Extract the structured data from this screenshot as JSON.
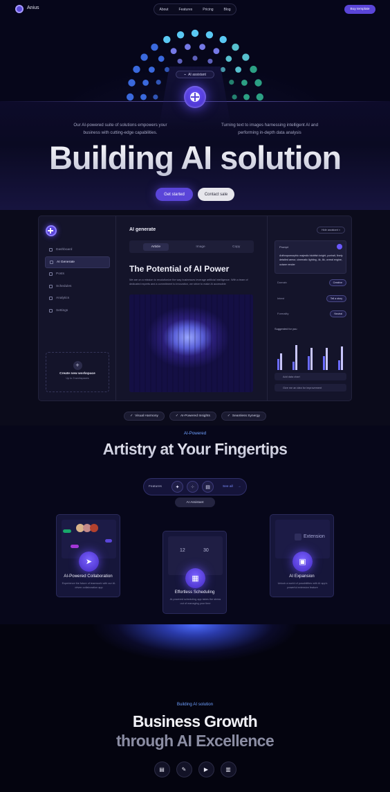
{
  "nav": {
    "brand": "Anius",
    "links": [
      "About",
      "Features",
      "Pricing",
      "Blog"
    ],
    "cta": "Buy template"
  },
  "hero": {
    "chip": "AI assistant",
    "left_text": "Our AI-powered suite of solutions empowers your business with cutting-edge capabilities.",
    "right_text": "Turning text to images harnessing intelligent AI and performing in-depth data analysis",
    "title": "Building AI solution",
    "primary_button": "Get started",
    "secondary_button": "Contact sale"
  },
  "dashboard": {
    "sidebar": [
      "Dashboard",
      "AI Generate",
      "Posts",
      "Schedules",
      "Analytics",
      "Settings"
    ],
    "workspace_title": "Create new workspace",
    "workspace_sub": "Up to 3 workspaces",
    "heading": "AI generate",
    "tabs": [
      "Article",
      "Image",
      "Copy"
    ],
    "article_title": "The Potential of AI Power",
    "article_text": "We are on a mission to revolutionize the way businesses leverage artificial intelligence. With a team of dedicated experts and a commitment to innovation, we strive to make AI accessible",
    "hide_button": "Hide assistant",
    "prompt_label": "Prompt",
    "prompt_text": "Anthropomorphic majestic blobfish knight, portrait, finely detailed armor, cinematic lighting, 4k, 8k, unreal engine, octane render",
    "options": [
      {
        "label": "Domain",
        "value": "Creative"
      },
      {
        "label": "Intent",
        "value": "Tell a story"
      },
      {
        "label": "Formality",
        "value": "Neutral"
      }
    ],
    "suggested": "Suggested for you",
    "actions": [
      "Add data chart",
      "Give me an idea for improvement"
    ]
  },
  "chips": [
    "Visual Harmony",
    "AI-Powered Insights",
    "Seamless Synergy"
  ],
  "features": {
    "kicker": "AI-Powered",
    "title": "Artistry at Your Fingertips",
    "bar_label": "Features",
    "see_all": "See all",
    "assistant_chip": "AI Assistant",
    "cards": [
      {
        "title": "AI-Powered Collaboration",
        "text": "Experience the future of teamwork with our AI-driven collaboration app"
      },
      {
        "title": "Effortless Scheduling",
        "text": "AI-powered scheduling app takes the stress out of managing your time"
      },
      {
        "title": "AI Expansion",
        "text": "Unlock a world of possibilities with AI app's powerful extension feature"
      }
    ],
    "schedule_nums": [
      "12",
      "30"
    ],
    "extension_label": "Extension"
  },
  "bottom": {
    "kicker": "Building AI solution",
    "title1": "Business Growth",
    "title2": "through AI Excellence"
  }
}
